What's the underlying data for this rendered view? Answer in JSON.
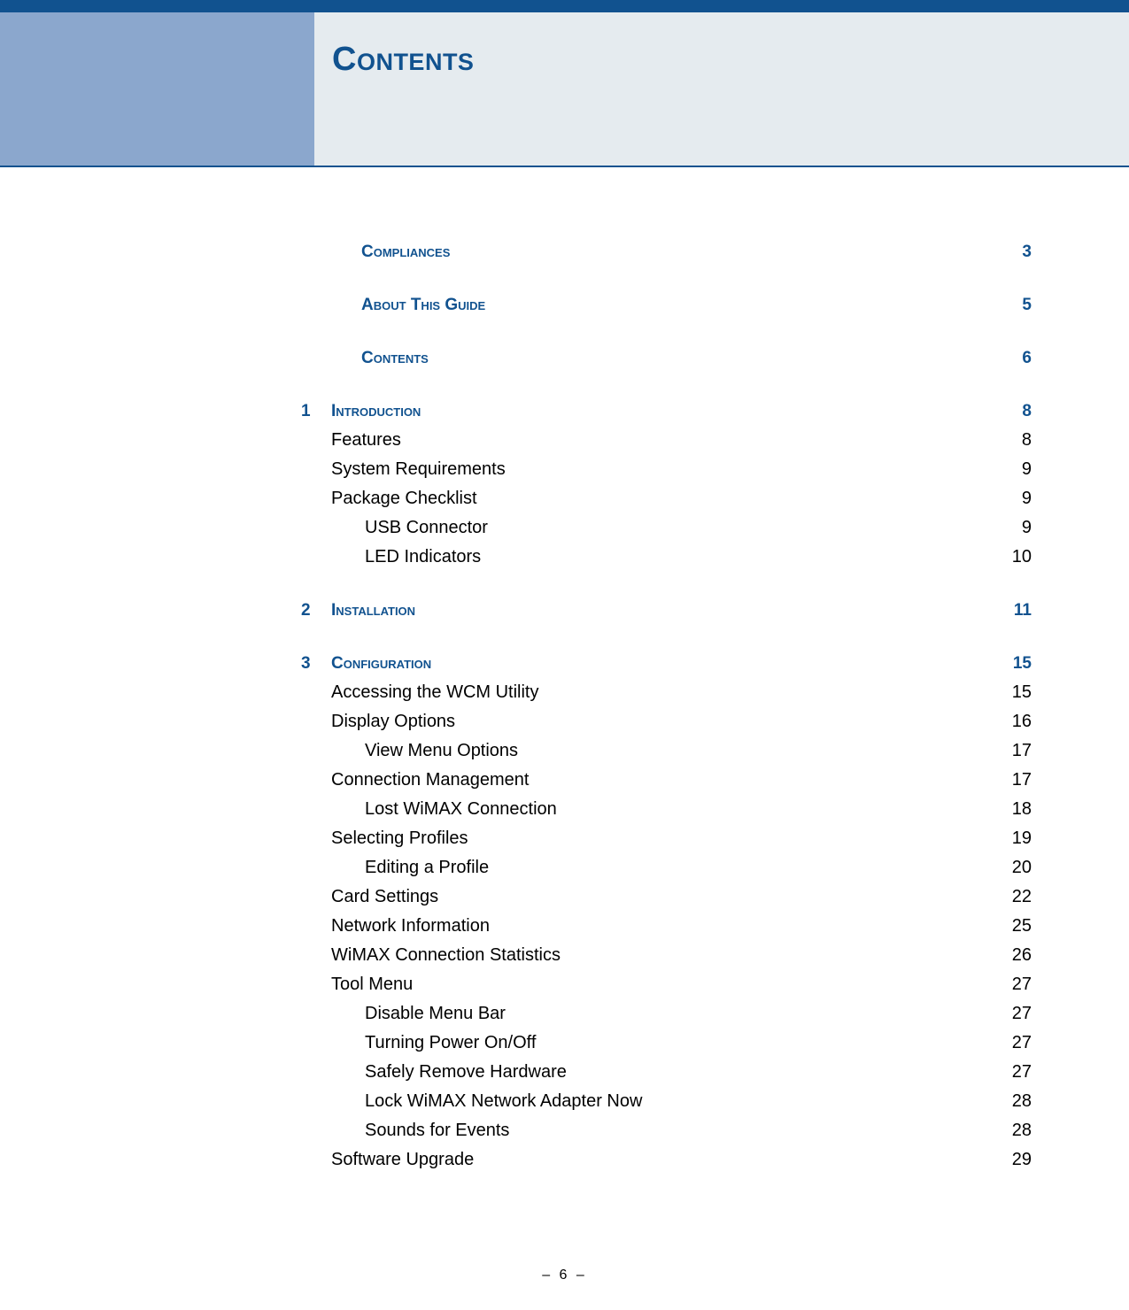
{
  "header": {
    "title": "Contents"
  },
  "toc": [
    {
      "type": "heading",
      "num": "",
      "title": "Compliances",
      "page": "3",
      "spacer": "md"
    },
    {
      "type": "heading",
      "num": "",
      "title": "About This Guide",
      "page": "5",
      "spacer": "md"
    },
    {
      "type": "heading",
      "num": "",
      "title": "Contents",
      "page": "6",
      "spacer": "md"
    },
    {
      "type": "heading",
      "num": "1",
      "title": "Introduction",
      "page": "8",
      "spacer": "none"
    },
    {
      "type": "item",
      "indent": 1,
      "title": "Features",
      "page": "8"
    },
    {
      "type": "item",
      "indent": 1,
      "title": "System Requirements",
      "page": "9"
    },
    {
      "type": "item",
      "indent": 1,
      "title": "Package Checklist",
      "page": "9"
    },
    {
      "type": "item",
      "indent": 2,
      "title": "USB Connector",
      "page": "9"
    },
    {
      "type": "item",
      "indent": 2,
      "title": "LED Indicators",
      "page": "10",
      "spacer": "md"
    },
    {
      "type": "heading",
      "num": "2",
      "title": "Installation",
      "page": "11",
      "spacer": "md"
    },
    {
      "type": "heading",
      "num": "3",
      "title": "Configuration",
      "page": "15",
      "spacer": "none"
    },
    {
      "type": "item",
      "indent": 1,
      "title": "Accessing the WCM Utility",
      "page": "15"
    },
    {
      "type": "item",
      "indent": 1,
      "title": "Display Options",
      "page": "16"
    },
    {
      "type": "item",
      "indent": 2,
      "title": "View Menu Options",
      "page": "17"
    },
    {
      "type": "item",
      "indent": 1,
      "title": "Connection Management",
      "page": "17"
    },
    {
      "type": "item",
      "indent": 2,
      "title": "Lost WiMAX Connection",
      "page": "18"
    },
    {
      "type": "item",
      "indent": 1,
      "title": "Selecting Profiles",
      "page": "19"
    },
    {
      "type": "item",
      "indent": 2,
      "title": "Editing a Profile",
      "page": "20"
    },
    {
      "type": "item",
      "indent": 1,
      "title": "Card Settings",
      "page": "22"
    },
    {
      "type": "item",
      "indent": 1,
      "title": "Network Information",
      "page": "25"
    },
    {
      "type": "item",
      "indent": 1,
      "title": "WiMAX Connection Statistics",
      "page": "26"
    },
    {
      "type": "item",
      "indent": 1,
      "title": "Tool Menu",
      "page": "27"
    },
    {
      "type": "item",
      "indent": 2,
      "title": "Disable Menu Bar",
      "page": "27"
    },
    {
      "type": "item",
      "indent": 2,
      "title": "Turning Power On/Off",
      "page": "27"
    },
    {
      "type": "item",
      "indent": 2,
      "title": "Safely Remove Hardware",
      "page": "27"
    },
    {
      "type": "item",
      "indent": 2,
      "title": "Lock WiMAX Network Adapter Now",
      "page": "28"
    },
    {
      "type": "item",
      "indent": 2,
      "title": "Sounds for Events",
      "page": "28"
    },
    {
      "type": "item",
      "indent": 1,
      "title": "Software Upgrade",
      "page": "29"
    }
  ],
  "footer": {
    "page_marker": "– 6 –"
  }
}
